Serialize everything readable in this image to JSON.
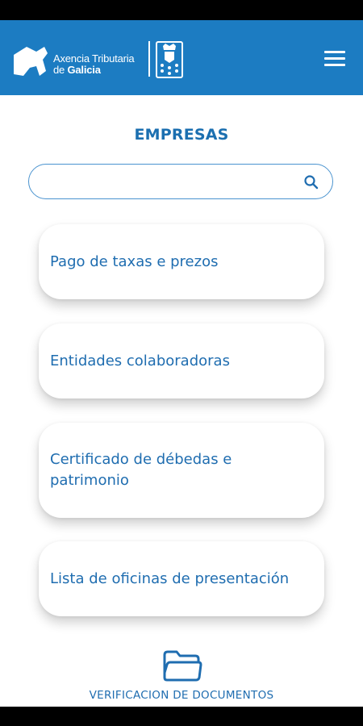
{
  "header": {
    "logo_line1": "Axencia Tributaria",
    "logo_line2_prefix": "de ",
    "logo_line2_bold": "Galicia",
    "menu_icon": "hamburger-menu-icon",
    "background_color": "#1c7cc2"
  },
  "page": {
    "title": "EMPRESAS"
  },
  "search": {
    "value": "",
    "placeholder": "",
    "icon": "search-icon"
  },
  "cards": [
    {
      "label": "Pago de taxas e prezos"
    },
    {
      "label": "Entidades colaboradoras"
    },
    {
      "label": "Certificado de débedas e patrimonio"
    },
    {
      "label": "Lista de oficinas de presentación"
    }
  ],
  "bottom": {
    "label": "VERIFICACION DE DOCUMENTOS",
    "icon": "folder-icon"
  },
  "colors": {
    "accent": "#1f6db0",
    "header": "#1c7cc2"
  }
}
